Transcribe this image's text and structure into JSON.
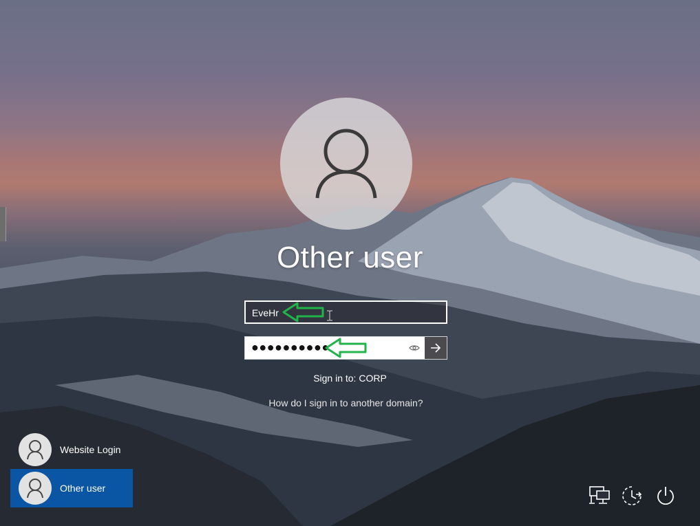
{
  "login": {
    "display_name": "Other user",
    "username_value": "EveHr",
    "password_mask": "●●●●●●●●●●",
    "sign_in_to": "Sign in to: CORP",
    "domain_help_link": "How do I sign in to another domain?"
  },
  "user_tiles": [
    {
      "label": "Website Login",
      "selected": false
    },
    {
      "label": "Other user",
      "selected": true
    }
  ],
  "system_icons": [
    "network-icon",
    "accessibility-icon",
    "power-icon"
  ],
  "colors": {
    "selected_tile": "#0a56a5",
    "annotation_arrow": "#22b34a",
    "submit_button": "#4b4b4f"
  }
}
